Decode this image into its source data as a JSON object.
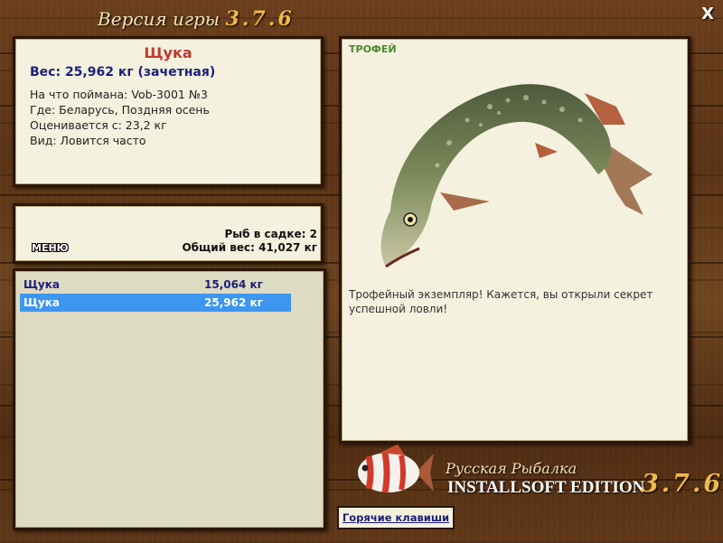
{
  "window": {
    "title": "Версия игры",
    "version": "3.7.6",
    "close_label": "X"
  },
  "info": {
    "fish_name": "Щука",
    "weight": "Вес: 25,962 кг (зачетная)",
    "caught_on": "На что поймана: Vob-3001 №3",
    "where": "Где: Беларусь, Поздняя осень",
    "rated_from": "Оценивается с: 23,2 кг",
    "kind": "Вид: Ловится часто"
  },
  "keepnet": {
    "menu_label": "МЕНЮ",
    "fish_count": "Рыб в садке: 2",
    "total_weight": "Общий вес: 41,027 кг"
  },
  "catch_list": [
    {
      "name": "Щука",
      "weight": "15,064 кг",
      "selected": false
    },
    {
      "name": "Щука",
      "weight": "25,962 кг",
      "selected": true
    }
  ],
  "detail": {
    "badge": "ТРОФЕЙ",
    "description": "Трофейный экземпляр! Кажется, вы открыли секрет успешной ловли!"
  },
  "branding": {
    "line1": "Русская Рыбалка",
    "line2": "INSTALLSOFT EDITION",
    "version": "3.7.6"
  },
  "hotkeys_label": "Горячие клавиши",
  "icons": [
    "close-icon",
    "pike-image",
    "logo-fish-icon"
  ]
}
